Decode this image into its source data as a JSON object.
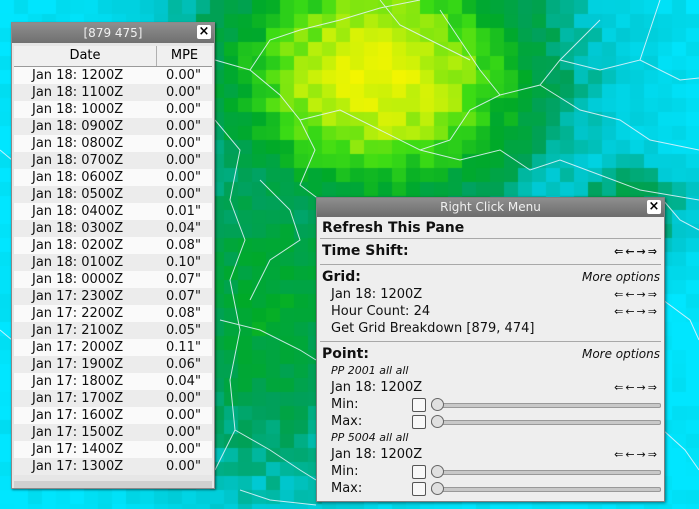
{
  "colors": {
    "map_low": "#00d8ff",
    "map_mid": "#00a040",
    "map_high": "#f0f000"
  },
  "table_window": {
    "title": "[879 475]",
    "close_glyph": "×",
    "headers": {
      "date": "Date",
      "mpe": "MPE"
    },
    "rows": [
      {
        "date": "Jan 18: 1200Z",
        "mpe": "0.00\""
      },
      {
        "date": "Jan 18: 1100Z",
        "mpe": "0.00\""
      },
      {
        "date": "Jan 18: 1000Z",
        "mpe": "0.00\""
      },
      {
        "date": "Jan 18: 0900Z",
        "mpe": "0.00\""
      },
      {
        "date": "Jan 18: 0800Z",
        "mpe": "0.00\""
      },
      {
        "date": "Jan 18: 0700Z",
        "mpe": "0.00\""
      },
      {
        "date": "Jan 18: 0600Z",
        "mpe": "0.00\""
      },
      {
        "date": "Jan 18: 0500Z",
        "mpe": "0.00\""
      },
      {
        "date": "Jan 18: 0400Z",
        "mpe": "0.01\""
      },
      {
        "date": "Jan 18: 0300Z",
        "mpe": "0.04\""
      },
      {
        "date": "Jan 18: 0200Z",
        "mpe": "0.08\""
      },
      {
        "date": "Jan 18: 0100Z",
        "mpe": "0.10\""
      },
      {
        "date": "Jan 18: 0000Z",
        "mpe": "0.07\""
      },
      {
        "date": "Jan 17: 2300Z",
        "mpe": "0.07\""
      },
      {
        "date": "Jan 17: 2200Z",
        "mpe": "0.08\""
      },
      {
        "date": "Jan 17: 2100Z",
        "mpe": "0.05\""
      },
      {
        "date": "Jan 17: 2000Z",
        "mpe": "0.11\""
      },
      {
        "date": "Jan 17: 1900Z",
        "mpe": "0.06\""
      },
      {
        "date": "Jan 17: 1800Z",
        "mpe": "0.04\""
      },
      {
        "date": "Jan 17: 1700Z",
        "mpe": "0.00\""
      },
      {
        "date": "Jan 17: 1600Z",
        "mpe": "0.00\""
      },
      {
        "date": "Jan 17: 1500Z",
        "mpe": "0.00\""
      },
      {
        "date": "Jan 17: 1400Z",
        "mpe": "0.00\""
      },
      {
        "date": "Jan 17: 1300Z",
        "mpe": "0.00\""
      }
    ]
  },
  "menu": {
    "title": "Right Click Menu",
    "close_glyph": "×",
    "refresh": "Refresh This Pane",
    "time_shift": {
      "label": "Time Shift:",
      "arrows": "⇐←→⇒"
    },
    "grid": {
      "label": "Grid:",
      "more": "More options",
      "time": "Jan 18: 1200Z",
      "hour_count": "Hour Count: 24",
      "breakdown": "Get Grid Breakdown [879, 474]",
      "arrows": "⇐←→⇒"
    },
    "point": {
      "label": "Point:",
      "more": "More options",
      "pp1": {
        "name": "PP 2001 all all",
        "time": "Jan 18: 1200Z",
        "min": "Min:",
        "max": "Max:",
        "arrows": "⇐←→⇒"
      },
      "pp2": {
        "name": "PP 5004 all all",
        "time": "Jan 18: 1200Z",
        "min": "Min:",
        "max": "Max:",
        "arrows": "⇐←→⇒"
      }
    }
  }
}
